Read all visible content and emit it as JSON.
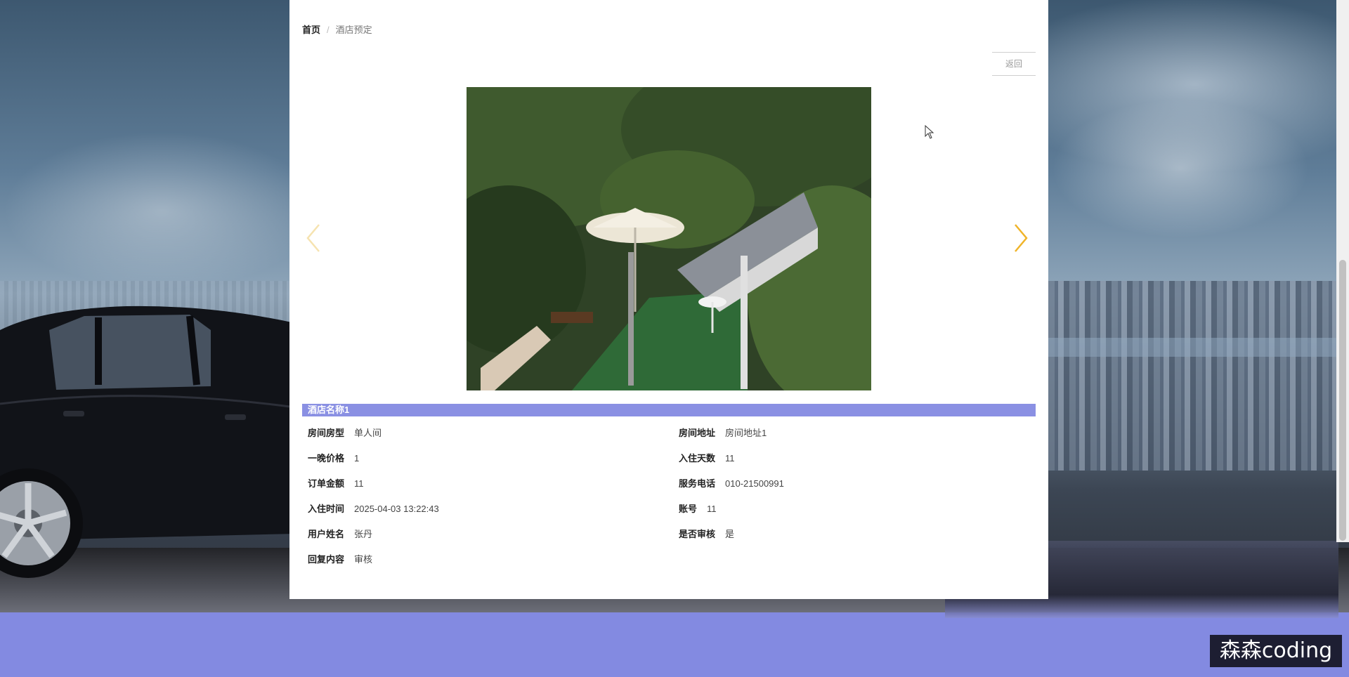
{
  "breadcrumb": {
    "home": "首页",
    "separator": "/",
    "current": "酒店预定"
  },
  "back_button": "返回",
  "carousel": {
    "prev_icon": "chevron-left-icon",
    "next_icon": "chevron-right-icon",
    "arrow_color": "#f0b429",
    "image_subject": "garden terrace with umbrella"
  },
  "hotel": {
    "title": "酒店名称1",
    "title_bar_color": "#8a90e3"
  },
  "details": {
    "room_type": {
      "label": "房间房型",
      "value": "单人间"
    },
    "room_address": {
      "label": "房间地址",
      "value": "房间地址1"
    },
    "night_price": {
      "label": "一晚价格",
      "value": "1"
    },
    "stay_days": {
      "label": "入住天数",
      "value": "11"
    },
    "order_amount": {
      "label": "订单金额",
      "value": "11"
    },
    "service_phone": {
      "label": "服务电话",
      "value": "010-21500991"
    },
    "checkin_time": {
      "label": "入住时间",
      "value": "2025-04-03 13:22:43"
    },
    "account": {
      "label": "账号",
      "value": "11"
    },
    "user_name": {
      "label": "用户姓名",
      "value": "张丹"
    },
    "approved": {
      "label": "是否审核",
      "value": "是"
    },
    "reply": {
      "label": "回复内容",
      "value": "审核"
    }
  },
  "footer": {
    "band_color": "#838ae1"
  },
  "watermark": "森森coding"
}
